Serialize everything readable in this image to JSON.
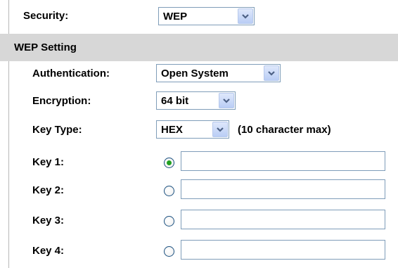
{
  "security": {
    "label": "Security:",
    "selected": "WEP"
  },
  "section": {
    "title": "WEP Setting"
  },
  "authentication": {
    "label": "Authentication:",
    "selected": "Open System"
  },
  "encryption": {
    "label": "Encryption:",
    "selected": "64 bit"
  },
  "key_type": {
    "label": "Key Type:",
    "selected": "HEX",
    "hint": "(10 character max)"
  },
  "keys": [
    {
      "label": "Key 1:",
      "selected": true,
      "value": ""
    },
    {
      "label": "Key 2:",
      "selected": false,
      "value": ""
    },
    {
      "label": "Key 3:",
      "selected": false,
      "value": ""
    },
    {
      "label": "Key 4:",
      "selected": false,
      "value": ""
    }
  ],
  "colors": {
    "section_bg": "#d7d7d7",
    "radio_selected": "#21a121",
    "dropdown_arrow": "#4d6185"
  },
  "icons": {
    "dropdown": "chevron-down-icon",
    "radio": "radio-button-icon"
  }
}
